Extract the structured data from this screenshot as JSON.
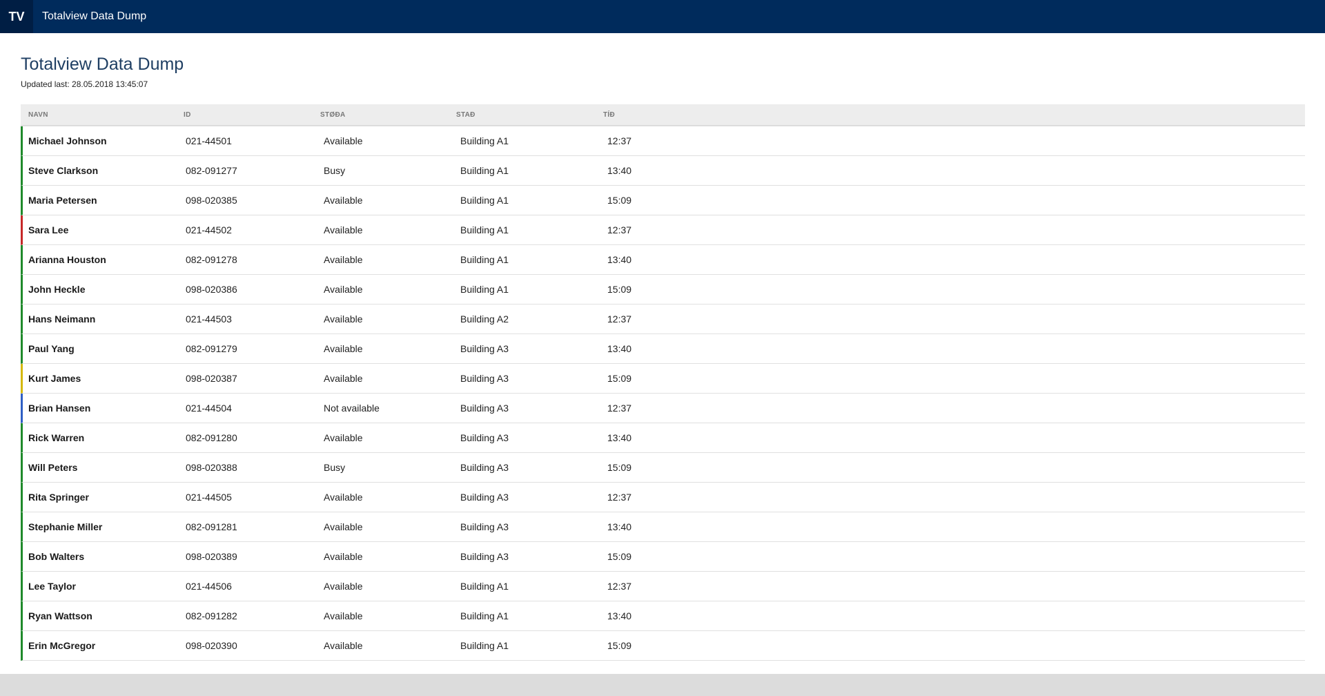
{
  "header": {
    "logo_text": "TV",
    "app_title": "Totalview Data Dump",
    "background_color": "#002b5c"
  },
  "page": {
    "title": "Totalview Data Dump",
    "updated": "Updated last: 28.05.2018 13:45:07"
  },
  "table": {
    "columns": [
      "NAVN",
      "ID",
      "STØÐA",
      "STAÐ",
      "TÍÐ"
    ],
    "rows": [
      {
        "name": "Michael Johnson",
        "id": "021-44501",
        "status": "Available",
        "location": "Building A1",
        "time": "12:37",
        "indicator": "#1f8a2b"
      },
      {
        "name": "Steve Clarkson",
        "id": "082-091277",
        "status": "Busy",
        "location": "Building A1",
        "time": "13:40",
        "indicator": "#1f8a2b"
      },
      {
        "name": "Maria Petersen",
        "id": "098-020385",
        "status": "Available",
        "location": "Building A1",
        "time": "15:09",
        "indicator": "#1f8a2b"
      },
      {
        "name": "Sara Lee",
        "id": "021-44502",
        "status": "Available",
        "location": "Building A1",
        "time": "12:37",
        "indicator": "#c62828"
      },
      {
        "name": "Arianna Houston",
        "id": "082-091278",
        "status": "Available",
        "location": "Building A1",
        "time": "13:40",
        "indicator": "#1f8a2b"
      },
      {
        "name": "John Heckle",
        "id": "098-020386",
        "status": "Available",
        "location": "Building A1",
        "time": "15:09",
        "indicator": "#1f8a2b"
      },
      {
        "name": "Hans Neimann",
        "id": "021-44503",
        "status": "Available",
        "location": "Building A2",
        "time": "12:37",
        "indicator": "#1f8a2b"
      },
      {
        "name": "Paul Yang",
        "id": "082-091279",
        "status": "Available",
        "location": "Building A3",
        "time": "13:40",
        "indicator": "#1f8a2b"
      },
      {
        "name": "Kurt James",
        "id": "098-020387",
        "status": "Available",
        "location": "Building A3",
        "time": "15:09",
        "indicator": "#d4b80a"
      },
      {
        "name": "Brian Hansen",
        "id": "021-44504",
        "status": "Not available",
        "location": "Building A3",
        "time": "12:37",
        "indicator": "#2f5fc4"
      },
      {
        "name": "Rick Warren",
        "id": "082-091280",
        "status": "Available",
        "location": "Building A3",
        "time": "13:40",
        "indicator": "#1f8a2b"
      },
      {
        "name": "Will Peters",
        "id": "098-020388",
        "status": "Busy",
        "location": "Building A3",
        "time": "15:09",
        "indicator": "#1f8a2b"
      },
      {
        "name": "Rita Springer",
        "id": "021-44505",
        "status": "Available",
        "location": "Building A3",
        "time": "12:37",
        "indicator": "#1f8a2b"
      },
      {
        "name": "Stephanie Miller",
        "id": "082-091281",
        "status": "Available",
        "location": "Building A3",
        "time": "13:40",
        "indicator": "#1f8a2b"
      },
      {
        "name": "Bob Walters",
        "id": "098-020389",
        "status": "Available",
        "location": "Building A3",
        "time": "15:09",
        "indicator": "#1f8a2b"
      },
      {
        "name": "Lee Taylor",
        "id": "021-44506",
        "status": "Available",
        "location": "Building A1",
        "time": "12:37",
        "indicator": "#1f8a2b"
      },
      {
        "name": "Ryan Wattson",
        "id": "082-091282",
        "status": "Available",
        "location": "Building A1",
        "time": "13:40",
        "indicator": "#1f8a2b"
      },
      {
        "name": "Erin McGregor",
        "id": "098-020390",
        "status": "Available",
        "location": "Building A1",
        "time": "15:09",
        "indicator": "#1f8a2b"
      }
    ]
  }
}
